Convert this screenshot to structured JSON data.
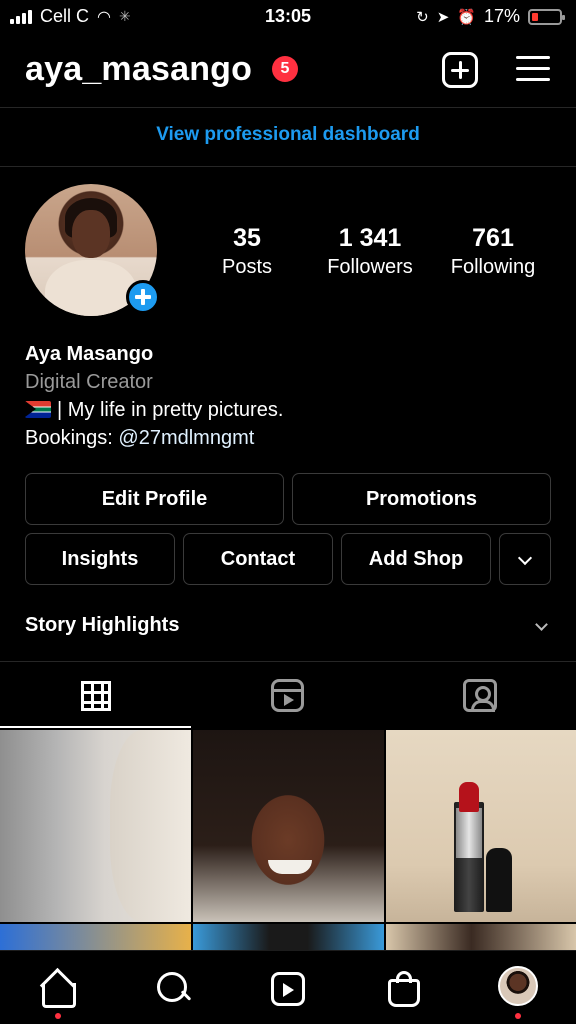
{
  "status_bar": {
    "carrier": "Cell C",
    "time": "13:05",
    "battery_percent": "17%",
    "battery_level": 0.17
  },
  "header": {
    "username": "aya_masango",
    "notification_count": "5",
    "new_post_icon": "plus-square-icon",
    "menu_icon": "hamburger-icon"
  },
  "dashboard_link": "View professional dashboard",
  "profile": {
    "stats": [
      {
        "value": "35",
        "label": "Posts"
      },
      {
        "value": "1 341",
        "label": "Followers"
      },
      {
        "value": "761",
        "label": "Following"
      }
    ],
    "name": "Aya Masango",
    "category": "Digital Creator",
    "bio_line": "| My life in pretty pictures.",
    "bookings_prefix": "Bookings: ",
    "bookings_handle": "@27mdlmngmt"
  },
  "buttons": {
    "edit_profile": "Edit Profile",
    "promotions": "Promotions",
    "insights": "Insights",
    "contact": "Contact",
    "add_shop": "Add Shop"
  },
  "highlights_label": "Story Highlights",
  "tabs": [
    "grid-icon",
    "reels-icon",
    "tagged-icon"
  ],
  "colors": {
    "accent_blue": "#1d9bf0",
    "badge_red": "#ff3040"
  }
}
